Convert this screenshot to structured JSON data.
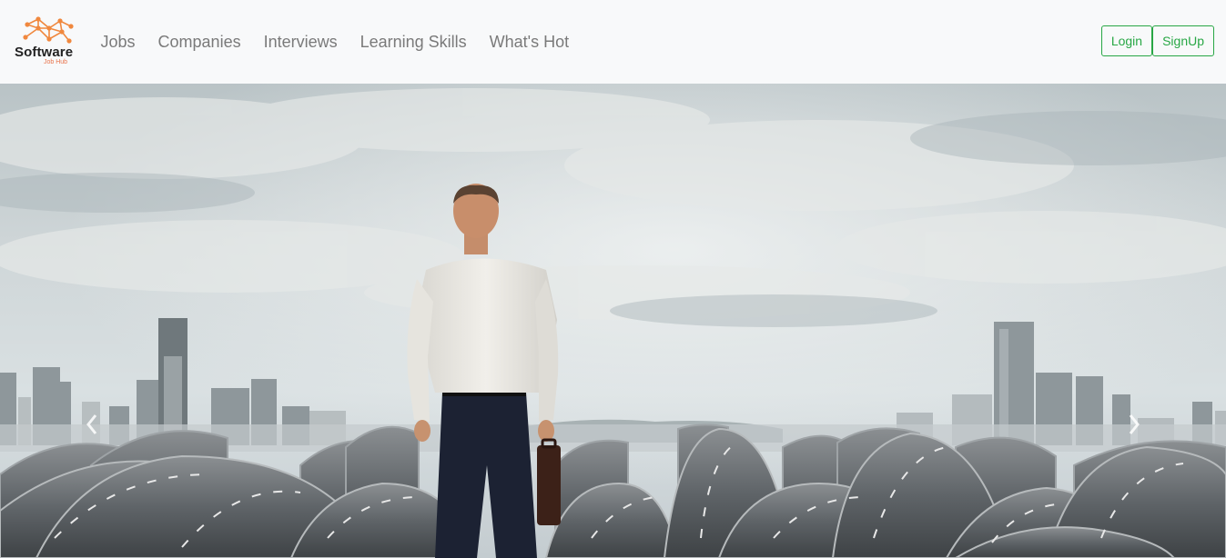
{
  "brand": {
    "name": "Software",
    "subtitle": "Job Hub",
    "logo_icon": "network-nodes-icon",
    "accent_color": "#f0883e"
  },
  "nav": {
    "items": [
      {
        "label": "Jobs"
      },
      {
        "label": "Companies"
      },
      {
        "label": "Interviews"
      },
      {
        "label": "Learning Skills"
      },
      {
        "label": "What's Hot"
      }
    ]
  },
  "auth": {
    "login_label": "Login",
    "signup_label": "SignUp",
    "color": "#28a745"
  },
  "hero": {
    "image": "businessman-facing-road-maze-with-city-skyline",
    "prev_icon": "chevron-left-icon",
    "next_icon": "chevron-right-icon"
  }
}
